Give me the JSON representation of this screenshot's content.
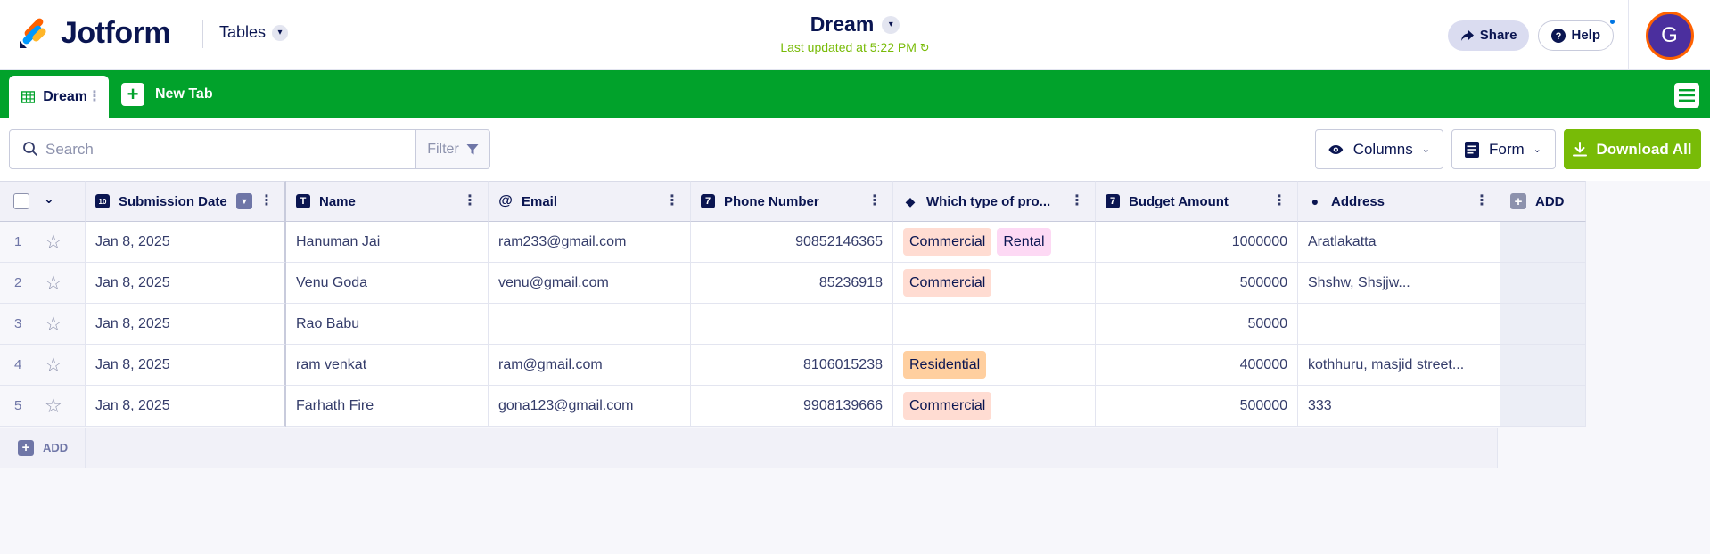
{
  "header": {
    "brand": "Jotform",
    "tables_label": "Tables",
    "doc_title": "Dream",
    "last_updated": "Last updated at 5:22 PM",
    "share_label": "Share",
    "help_label": "Help",
    "avatar_initial": "G"
  },
  "tabs": {
    "active_label": "Dream",
    "new_tab_label": "New Tab"
  },
  "toolbar": {
    "search_placeholder": "Search",
    "filter_label": "Filter",
    "columns_label": "Columns",
    "form_label": "Form",
    "download_label": "Download All"
  },
  "table": {
    "columns": [
      {
        "label": "Submission Date",
        "icon": "calendar-icon"
      },
      {
        "label": "Name",
        "icon": "text-icon"
      },
      {
        "label": "Email",
        "icon": "at-icon"
      },
      {
        "label": "Phone Number",
        "icon": "number-icon"
      },
      {
        "label": "Which type of pro...",
        "icon": "tag-icon"
      },
      {
        "label": "Budget Amount",
        "icon": "number-icon"
      },
      {
        "label": "Address",
        "icon": "location-icon"
      }
    ],
    "add_column_label": "ADD",
    "add_row_label": "ADD",
    "rows": [
      {
        "index": "1",
        "date": "Jan 8, 2025",
        "name": "Hanuman Jai",
        "email": "ram233@gmail.com",
        "phone": "90852146365",
        "types": [
          "Commercial",
          "Rental"
        ],
        "budget": "1000000",
        "address": "Aratlakatta"
      },
      {
        "index": "2",
        "date": "Jan 8, 2025",
        "name": "Venu Goda",
        "email": "venu@gmail.com",
        "phone": "85236918",
        "types": [
          "Commercial"
        ],
        "budget": "500000",
        "address": "Shshw, Shsjjw..."
      },
      {
        "index": "3",
        "date": "Jan 8, 2025",
        "name": "Rao Babu",
        "email": "",
        "phone": "",
        "types": [],
        "budget": "50000",
        "address": ""
      },
      {
        "index": "4",
        "date": "Jan 8, 2025",
        "name": "ram venkat",
        "email": "ram@gmail.com",
        "phone": "8106015238",
        "types": [
          "Residential"
        ],
        "budget": "400000",
        "address": "kothhuru, masjid street..."
      },
      {
        "index": "5",
        "date": "Jan 8, 2025",
        "name": "Farhath Fire",
        "email": "gona123@gmail.com",
        "phone": "9908139666",
        "types": [
          "Commercial"
        ],
        "budget": "500000",
        "address": "333"
      }
    ]
  },
  "colors": {
    "brand_navy": "#0a1551",
    "tabbar_green": "#01a22b",
    "download_green": "#78bb07",
    "tag_commercial": "#ffdcd2",
    "tag_rental": "#fdd9f4",
    "tag_residential": "#ffcf9f"
  }
}
